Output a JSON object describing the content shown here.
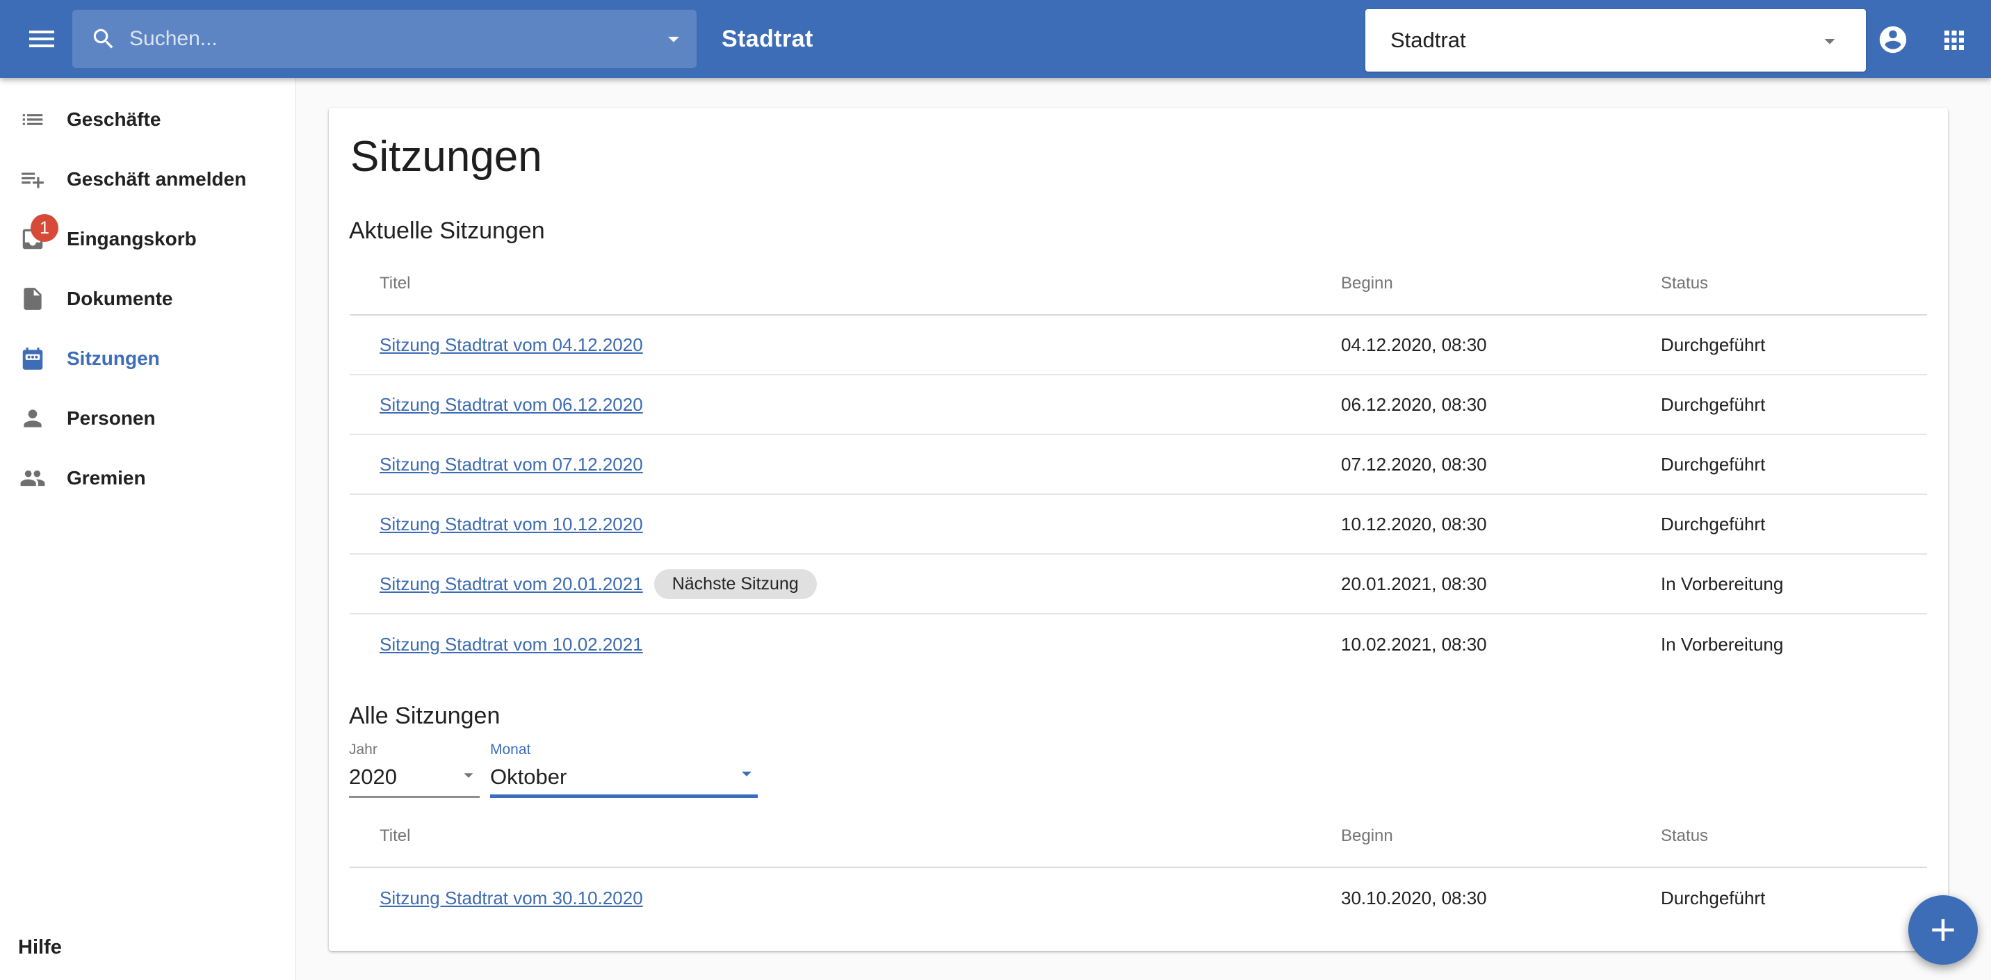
{
  "colors": {
    "primary": "#3e6db7",
    "link": "#3c6bb3",
    "focus": "#3a6cc0",
    "badge": "#d84a38",
    "chip": "#e0e0e0"
  },
  "appbar": {
    "search_placeholder": "Suchen...",
    "title": "Stadtrat",
    "tenant_select_value": "Stadtrat"
  },
  "sidebar": {
    "items": [
      {
        "label": "Geschäfte",
        "icon": "list-icon"
      },
      {
        "label": "Geschäft anmelden",
        "icon": "playlist-add-icon"
      },
      {
        "label": "Eingangskorb",
        "icon": "inbox-icon",
        "badge": "1"
      },
      {
        "label": "Dokumente",
        "icon": "document-icon"
      },
      {
        "label": "Sitzungen",
        "icon": "calendar-icon",
        "active": true
      },
      {
        "label": "Personen",
        "icon": "person-icon"
      },
      {
        "label": "Gremien",
        "icon": "people-icon"
      }
    ],
    "help_label": "Hilfe"
  },
  "main": {
    "page_title": "Sitzungen",
    "sections": {
      "current": {
        "heading": "Aktuelle Sitzungen",
        "columns": [
          "Titel",
          "Beginn",
          "Status"
        ],
        "rows": [
          {
            "title": "Sitzung Stadtrat vom 04.12.2020",
            "begin": "04.12.2020, 08:30",
            "status": "Durchgeführt"
          },
          {
            "title": "Sitzung Stadtrat vom 06.12.2020",
            "begin": "06.12.2020, 08:30",
            "status": "Durchgeführt"
          },
          {
            "title": "Sitzung Stadtrat vom 07.12.2020",
            "begin": "07.12.2020, 08:30",
            "status": "Durchgeführt"
          },
          {
            "title": "Sitzung Stadtrat vom 10.12.2020",
            "begin": "10.12.2020, 08:30",
            "status": "Durchgeführt"
          },
          {
            "title": "Sitzung Stadtrat vom 20.01.2021",
            "chip": "Nächste Sitzung",
            "begin": "20.01.2021, 08:30",
            "status": "In Vorbereitung"
          },
          {
            "title": "Sitzung Stadtrat vom 10.02.2021",
            "begin": "10.02.2021, 08:30",
            "status": "In Vorbereitung"
          }
        ]
      },
      "all": {
        "heading": "Alle Sitzungen",
        "filters": {
          "year_label": "Jahr",
          "year_value": "2020",
          "month_label": "Monat",
          "month_value": "Oktober"
        },
        "columns": [
          "Titel",
          "Beginn",
          "Status"
        ],
        "rows": [
          {
            "title": "Sitzung Stadtrat vom 30.10.2020",
            "begin": "30.10.2020, 08:30",
            "status": "Durchgeführt"
          }
        ]
      }
    }
  },
  "fab": {
    "icon": "plus-icon"
  }
}
